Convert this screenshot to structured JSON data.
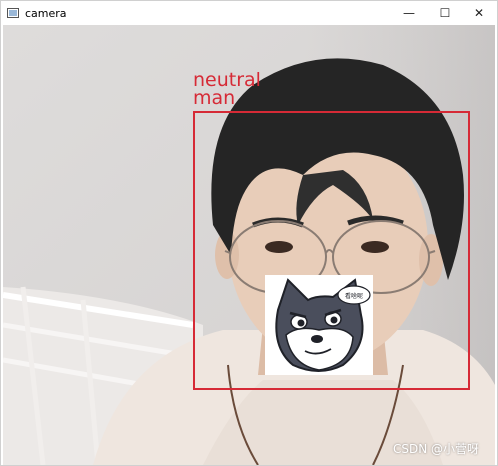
{
  "window": {
    "title": "camera",
    "controls": {
      "minimize": "—",
      "maximize": "☐",
      "close": "✕"
    }
  },
  "detection": {
    "emotion_label": "neutral",
    "gender_label": "man",
    "box_color": "#d62a36"
  },
  "sticker": {
    "speech_text": "看啥呢",
    "icon": "cartoon-dog-face"
  },
  "watermark": {
    "text": "CSDN @小菅呀"
  },
  "colors": {
    "background_wall": "#dcdad9",
    "sweater": "#efe6df",
    "hair": "#252525",
    "skin": "#e8cdb9"
  }
}
